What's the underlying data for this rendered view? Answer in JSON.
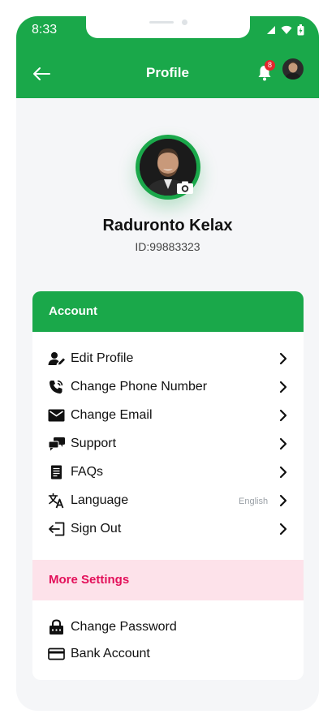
{
  "status_bar": {
    "time": "8:33"
  },
  "header": {
    "title": "Profile",
    "notification_count": "8"
  },
  "profile": {
    "name": "Raduronto Kelax",
    "id": "ID:99883323"
  },
  "account_section": {
    "title": "Account",
    "items": [
      {
        "label": "Edit Profile",
        "icon": "user-edit-icon"
      },
      {
        "label": "Change Phone Number",
        "icon": "phone-icon"
      },
      {
        "label": "Change Email",
        "icon": "mail-icon"
      },
      {
        "label": "Support",
        "icon": "support-chat-icon"
      },
      {
        "label": "FAQs",
        "icon": "document-icon"
      },
      {
        "label": "Language",
        "icon": "translate-icon",
        "value": "English"
      },
      {
        "label": "Sign Out",
        "icon": "sign-out-icon"
      }
    ]
  },
  "more_settings_section": {
    "title": "More Settings",
    "items": [
      {
        "label": "Change Password",
        "icon": "lock-icon"
      },
      {
        "label": "Bank Account",
        "icon": "card-icon"
      }
    ]
  },
  "colors": {
    "primary": "#1aa84a",
    "accent": "#e3105a",
    "accent_bg": "#fde2ea",
    "background": "#f5f6f8"
  }
}
